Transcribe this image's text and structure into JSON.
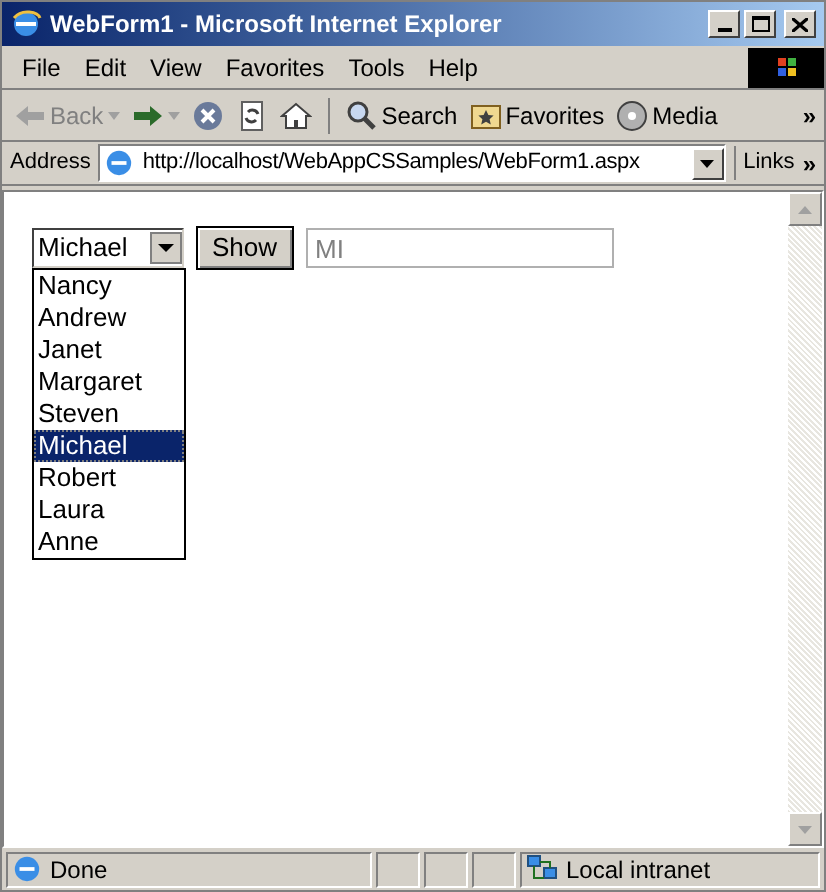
{
  "window": {
    "title": "WebForm1 - Microsoft Internet Explorer"
  },
  "menu": [
    "File",
    "Edit",
    "View",
    "Favorites",
    "Tools",
    "Help"
  ],
  "toolbar": [
    {
      "kind": "back",
      "label": "Back",
      "disabled": true
    },
    {
      "kind": "forward",
      "disabled": false
    },
    {
      "kind": "stop",
      "disabled": false
    },
    {
      "kind": "refresh",
      "disabled": false
    },
    {
      "kind": "home",
      "disabled": false
    },
    {
      "kind": "search",
      "label": "Search",
      "disabled": false
    },
    {
      "kind": "favorites",
      "label": "Favorites",
      "disabled": false
    },
    {
      "kind": "media",
      "label": "Media",
      "disabled": false
    }
  ],
  "toolbar_more": "»",
  "address": {
    "label": "Address",
    "value": "http://localhost/WebAppCSSamples/WebForm1.aspx",
    "links": "Links",
    "links_more": "»"
  },
  "form": {
    "dropdown": {
      "value": "Michael",
      "expanded": true,
      "options": [
        {
          "label": "Nancy",
          "selected": false
        },
        {
          "label": "Andrew",
          "selected": false
        },
        {
          "label": "Janet",
          "selected": false
        },
        {
          "label": "Margaret",
          "selected": false
        },
        {
          "label": "Steven",
          "selected": false
        },
        {
          "label": "Michael",
          "selected": true
        },
        {
          "label": "Robert",
          "selected": false
        },
        {
          "label": "Laura",
          "selected": false
        },
        {
          "label": "Anne",
          "selected": false
        }
      ]
    },
    "button": "Show",
    "field": {
      "value": "MI",
      "disabled": true
    }
  },
  "status_bar": {
    "text": "Done",
    "zone": "Local intranet"
  }
}
